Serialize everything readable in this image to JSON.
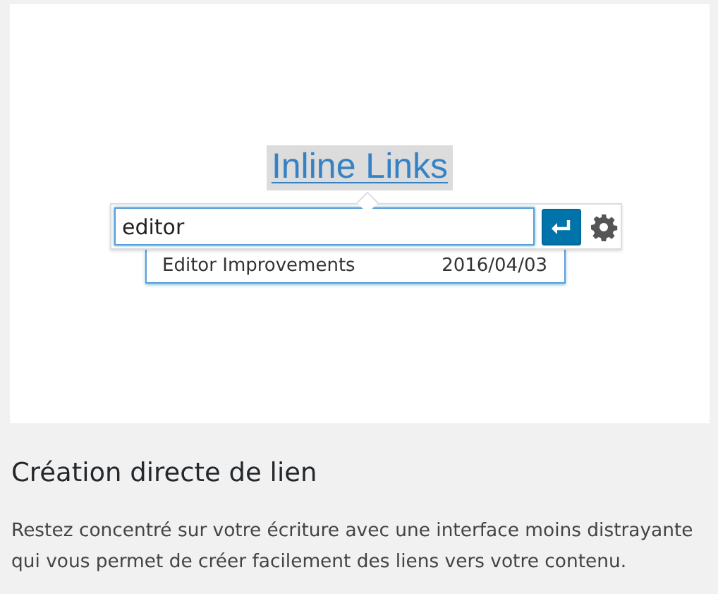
{
  "editor": {
    "link_text": "Inline Links",
    "search": {
      "value": "editor"
    },
    "suggestions": [
      {
        "title": "Editor Improvements",
        "date": "2016/04/03",
        "selected": false
      }
    ]
  },
  "feature": {
    "title": "Création directe de lien",
    "description": "Restez concentré sur votre écriture avec une interface moins distrayante qui vous permet de créer facilement des liens vers votre contenu."
  }
}
